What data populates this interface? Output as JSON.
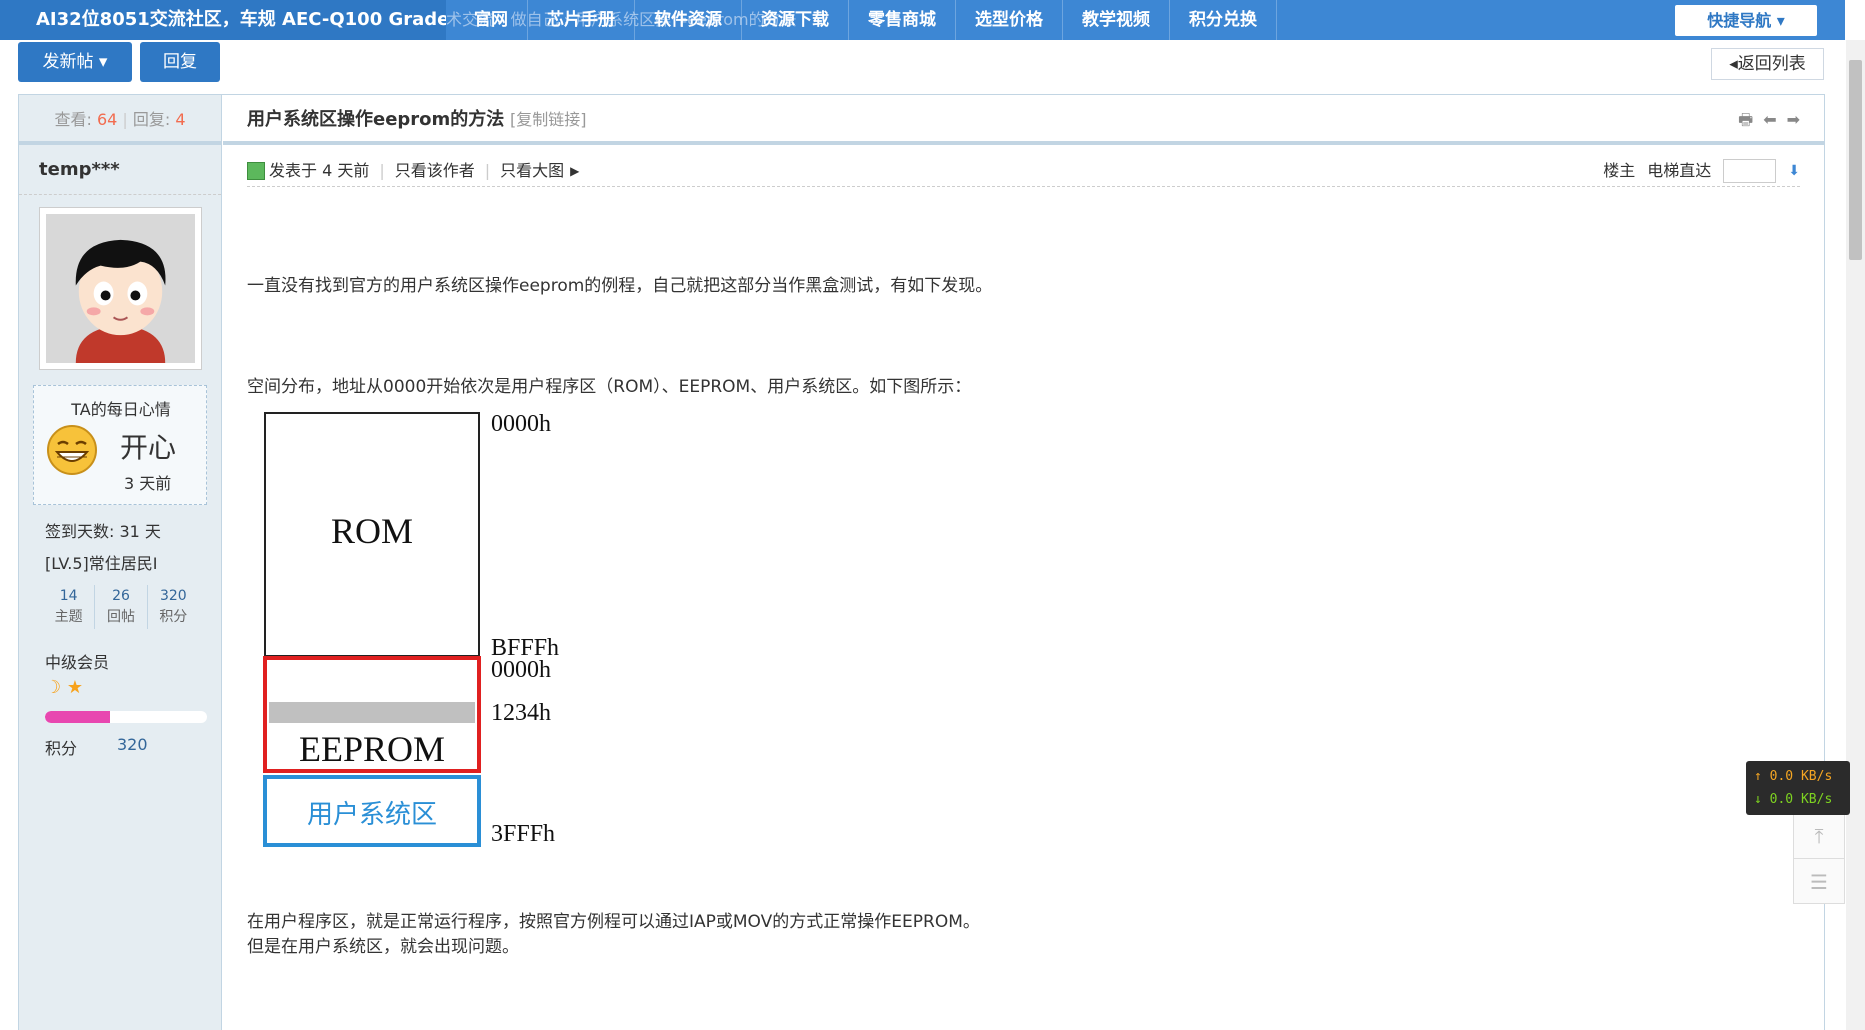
{
  "topnav": {
    "brand": "AI32位8051交流社区，车规 AEC-Q100 Grade1",
    "ghost_text": "技术交流 › 做自己 › 用户系统区操作eeprom的方法",
    "items": [
      "官网",
      "芯片手册",
      "软件资源",
      "资源下载",
      "零售商城",
      "选型价格",
      "教学视频",
      "积分兑换"
    ],
    "quicknav": "快捷导航 ▾"
  },
  "actions": {
    "newpost": "发新帖 ▾",
    "reply": "回复",
    "back": "◂返回列表"
  },
  "sidebar": {
    "stats_view_label": "查看:",
    "stats_view": "64",
    "stats_reply_label": "回复:",
    "stats_reply": "4",
    "username": "temp***",
    "mood_title": "TA的每日心情",
    "mood_state": "开心",
    "mood_time": "3 天前",
    "signdays": "签到天数: 31 天",
    "level": "[LV.5]常住居民I",
    "userstats": [
      {
        "value": "14",
        "label": "主题"
      },
      {
        "value": "26",
        "label": "回帖"
      },
      {
        "value": "320",
        "label": "积分"
      }
    ],
    "group": "中级会员",
    "medals": "☽ ★",
    "progress": 0.4,
    "points_label": "积分",
    "points_value": "320"
  },
  "post": {
    "title": "用户系统区操作eeprom的方法",
    "copy_link": "[复制链接]",
    "posted": "发表于 4 天前",
    "author_only": "只看该作者",
    "big_images": "只看大图",
    "floor": "楼主",
    "jump_label": "电梯直达",
    "p1": "一直没有找到官方的用户系统区操作eeprom的例程，自己就把这部分当作黑盒测试，有如下发现。",
    "p2": "空间分布，地址从0000开始依次是用户程序区（ROM）、EEPROM、用户系统区。如下图所示：",
    "p3": "在用户程序区，就是正常运行程序，按照官方例程可以通过IAP或MOV的方式正常操作EEPROM。",
    "p4": "但是在用户系统区，就会出现问题。"
  },
  "diagram": {
    "rom_label": "ROM",
    "eeprom_label": "EEPROM",
    "sys_label": "用户系统区",
    "addr_0000a": "0000h",
    "addr_bfff": "BFFFh",
    "addr_0000b": "0000h",
    "addr_1234": "1234h",
    "addr_3fff": "3FFFh",
    "colors": {
      "eeprom_border": "#e02020",
      "sys_border": "#2a8fd6",
      "sys_text": "#2a8fd6",
      "highlight": "#c0c0c0"
    }
  },
  "netspeed": {
    "up": "↑ 0.0 KB/s",
    "down": "↓ 0.0 KB/s"
  }
}
